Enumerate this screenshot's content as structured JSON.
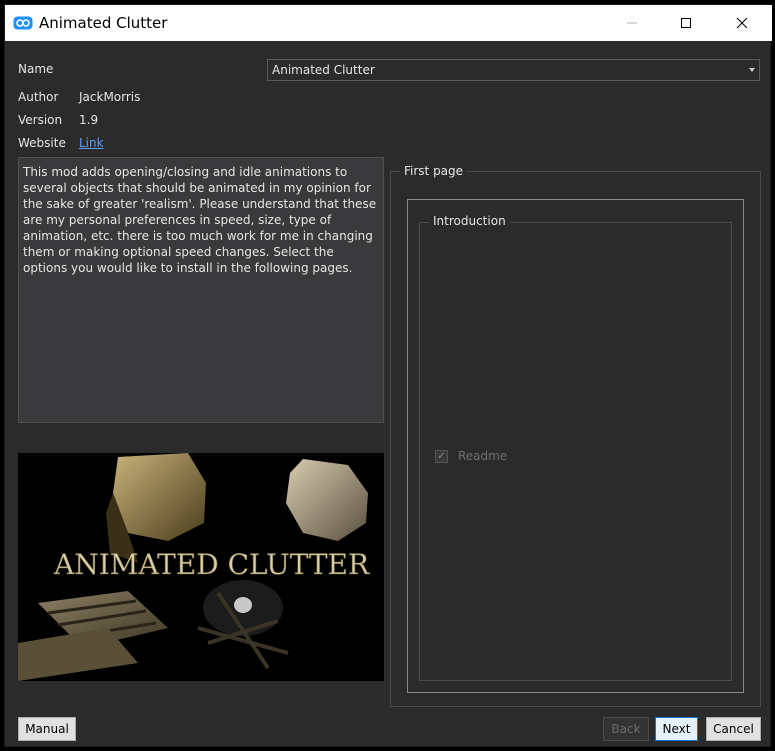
{
  "window": {
    "title": "Animated Clutter"
  },
  "info": {
    "name_label": "Name",
    "name_value": "Animated Clutter",
    "author_label": "Author",
    "author_value": "JackMorris",
    "version_label": "Version",
    "version_value": "1.9",
    "website_label": "Website",
    "website_link": "Link"
  },
  "description": "This mod adds opening/closing and idle animations to several objects that should be animated in my opinion for the sake of greater 'realism'. Please understand that these are my personal preferences in speed, size, type of animation, etc. there is too much work for me in changing them or making optional speed changes. Select the options you would like to install in the following pages.",
  "banner": {
    "text": "ANIMATED CLUTTER"
  },
  "page": {
    "title": "First page",
    "group_title": "Introduction",
    "option_label": "Readme",
    "option_checked": true
  },
  "buttons": {
    "manual": "Manual",
    "back": "Back",
    "next": "Next",
    "cancel": "Cancel"
  }
}
